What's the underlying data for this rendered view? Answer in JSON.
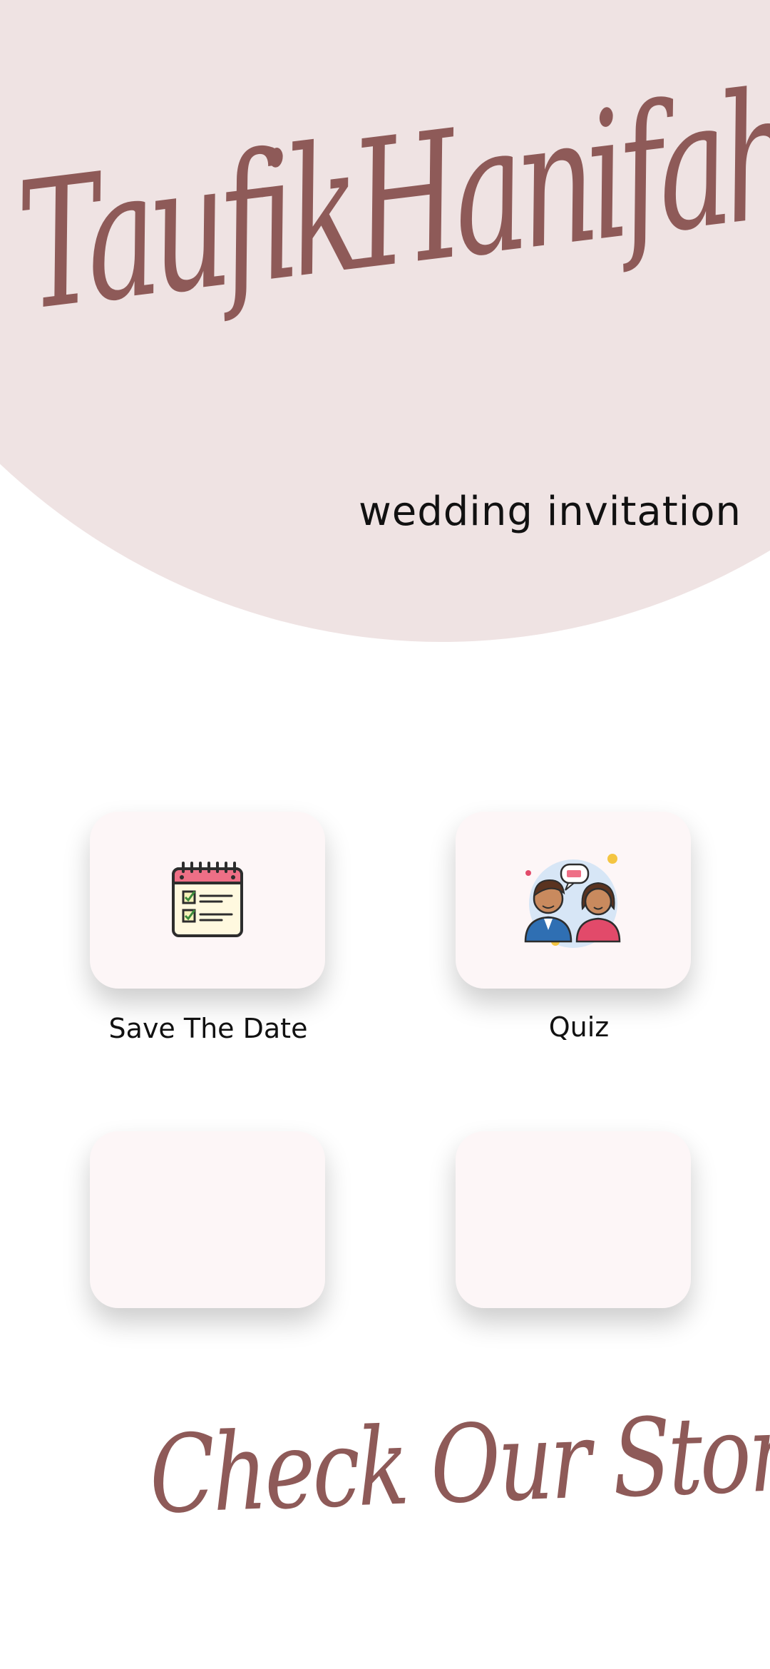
{
  "header": {
    "couple_names": "TaufikHanifah",
    "subtitle": "wedding invitation"
  },
  "menu": {
    "items": [
      {
        "label": "Save The Date",
        "icon": "calendar-checklist-icon"
      },
      {
        "label": "Quiz",
        "icon": "couple-chat-icon"
      },
      {
        "label": "",
        "icon": ""
      },
      {
        "label": "",
        "icon": ""
      }
    ]
  },
  "footer": {
    "story_link": "Check Our Story"
  },
  "colors": {
    "blob": "#efe3e3",
    "script": "#8e5a58",
    "card": "#fdf6f7"
  }
}
